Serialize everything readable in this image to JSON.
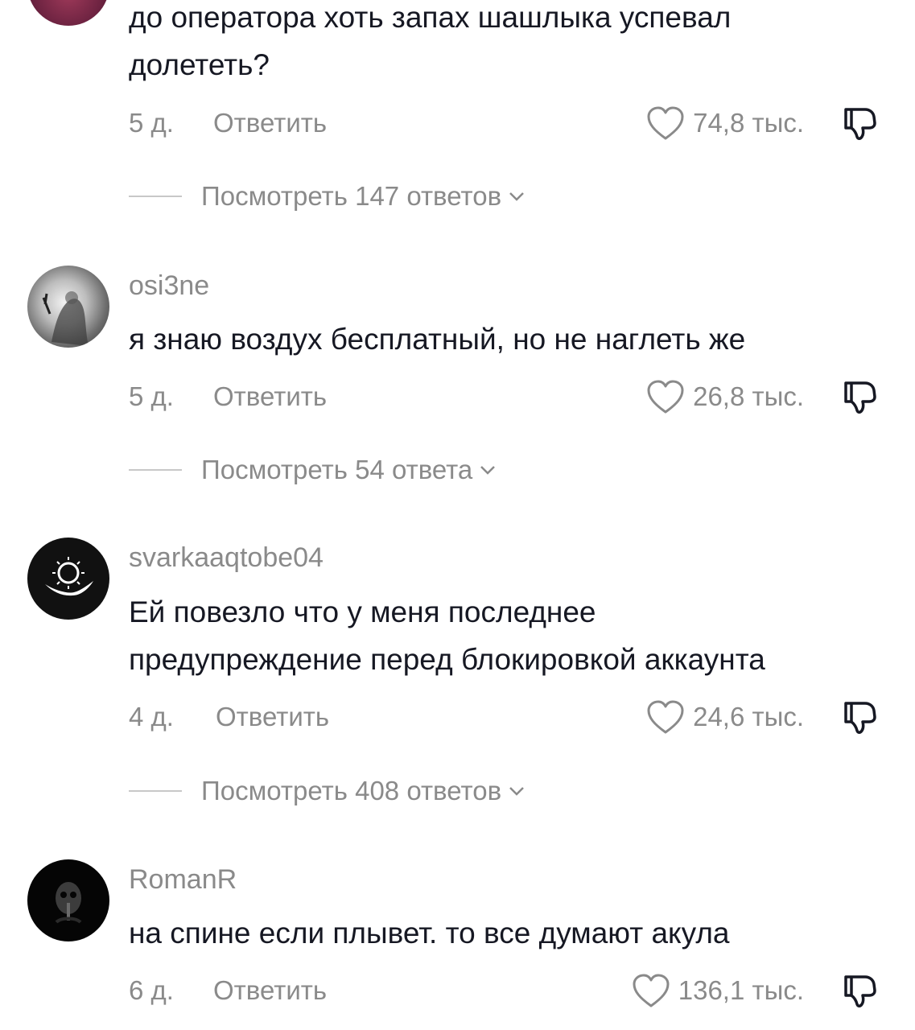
{
  "comments": [
    {
      "username": "",
      "text_lines": [
        "до оператора хоть запах шашлыка успевал",
        "долететь?"
      ],
      "age": "5 д.",
      "reply_label": "Ответить",
      "likes": "74,8 тыс.",
      "replies_label": "Посмотреть 147 ответов"
    },
    {
      "username": "osi3ne",
      "text_lines": [
        "я знаю воздух бесплатный, но не наглеть же"
      ],
      "age": "5 д.",
      "reply_label": "Ответить",
      "likes": "26,8 тыс.",
      "replies_label": "Посмотреть 54 ответа"
    },
    {
      "username": "svarkaaqtobe04",
      "text_lines": [
        "Ей повезло что у меня последнее",
        "предупреждение перед блокировкой аккаунта"
      ],
      "age": "4 д.",
      "reply_label": "Ответить",
      "likes": "24,6 тыс.",
      "replies_label": "Посмотреть 408 ответов"
    },
    {
      "username": "RomanR",
      "text_lines": [
        "на спине если плывет. то все думают акула"
      ],
      "age": "6 д.",
      "reply_label": "Ответить",
      "likes": "136,1 тыс.",
      "replies_label": ""
    }
  ],
  "icons": {
    "like": "heart-outline-icon",
    "dislike": "thumbs-down-icon",
    "expand": "chevron-down-icon"
  },
  "colors": {
    "text": "#161823",
    "secondary": "#8a8a8a",
    "divider": "#c8c8c8"
  }
}
